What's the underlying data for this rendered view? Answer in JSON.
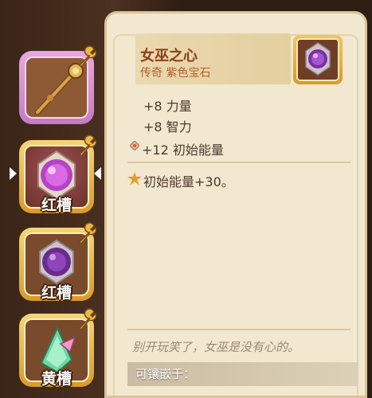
{
  "item": {
    "name": "女巫之心",
    "subtitle": "传奇 紫色宝石",
    "stats": [
      "+8 力量",
      "+8 智力",
      "+12 初始能量"
    ],
    "effect": "初始能量+30。",
    "flavor": "别开玩笑了，女巫是没有心的。",
    "socket_label": "可镶嵌于："
  },
  "slots": [
    {
      "kind": "weapon",
      "label": ""
    },
    {
      "kind": "gem",
      "label": "红槽",
      "selected": true
    },
    {
      "kind": "gem",
      "label": "红槽"
    },
    {
      "kind": "gem",
      "label": "黄槽"
    }
  ],
  "colors": {
    "panel_bg": "#f2e7cf",
    "title": "#8b3f18",
    "accent_gold": "#e6a83a",
    "weapon_frame": "#d48fd0"
  }
}
